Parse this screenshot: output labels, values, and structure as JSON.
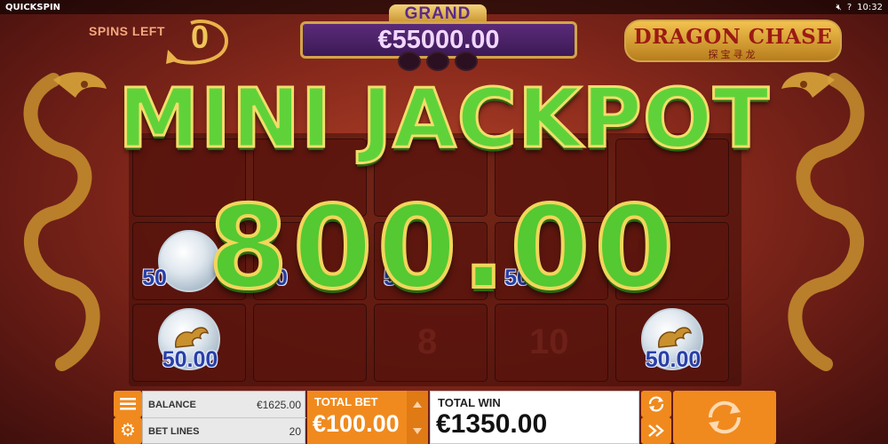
{
  "topbar": {
    "brand": "QUICKSPIN",
    "sound_icon": "speaker-muted-icon",
    "help_icon": "question-icon",
    "clock": "10:32"
  },
  "spins": {
    "label": "SPINS LEFT",
    "value": "0"
  },
  "grand": {
    "label": "GRAND",
    "amount": "€55000.00"
  },
  "logo": {
    "title": "DRAGON CHASE",
    "subtitle": "探宝寻龙"
  },
  "win": {
    "title": "MINI JACKPOT",
    "amount": "800.00"
  },
  "reels": {
    "coins": [
      "50",
      "50",
      "50",
      "50",
      "50.00",
      "50.00"
    ],
    "ghost_symbols": [
      "8",
      "10"
    ]
  },
  "controls": {
    "balance_label": "BALANCE",
    "balance_value": "€1625.00",
    "betlines_label": "BET LINES",
    "betlines_value": "20",
    "totalbet_label": "TOTAL BET",
    "totalbet_value": "€100.00",
    "totalwin_label": "TOTAL WIN",
    "totalwin_value": "€1350.00"
  },
  "colors": {
    "accent": "#f08a1e",
    "jackpot_green": "#54c932",
    "grand_purple": "#4a2268"
  }
}
